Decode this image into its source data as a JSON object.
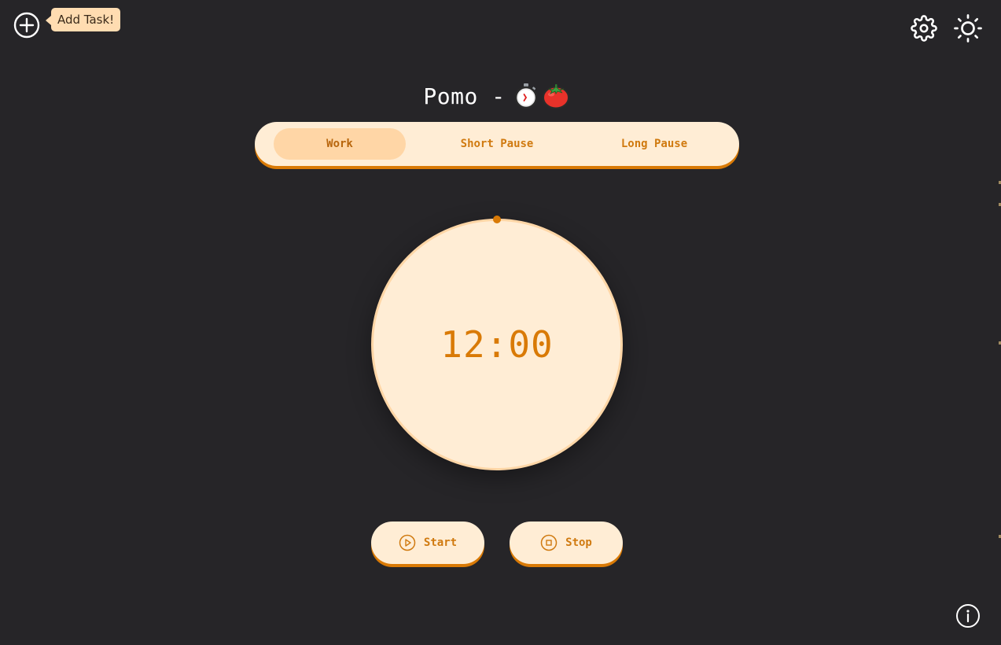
{
  "header": {
    "add_task_tooltip": "Add Task!",
    "icons": {
      "add": "plus-circle-icon",
      "settings": "gear-icon",
      "theme": "sun-icon",
      "info": "info-icon"
    }
  },
  "title": {
    "text": "Pomo -",
    "emojis": [
      "stopwatch",
      "tomato"
    ]
  },
  "tabs": [
    {
      "label": "Work",
      "active": true
    },
    {
      "label": "Short Pause",
      "active": false
    },
    {
      "label": "Long Pause",
      "active": false
    }
  ],
  "timer": {
    "time": "12:00",
    "progress": 0
  },
  "controls": {
    "start_label": "Start",
    "stop_label": "Stop"
  },
  "colors": {
    "background": "#262528",
    "panel": "#ffedd5",
    "accent": "#d97a06",
    "active_tab": "#ffd6a6",
    "tooltip": "#ffdcb1"
  }
}
